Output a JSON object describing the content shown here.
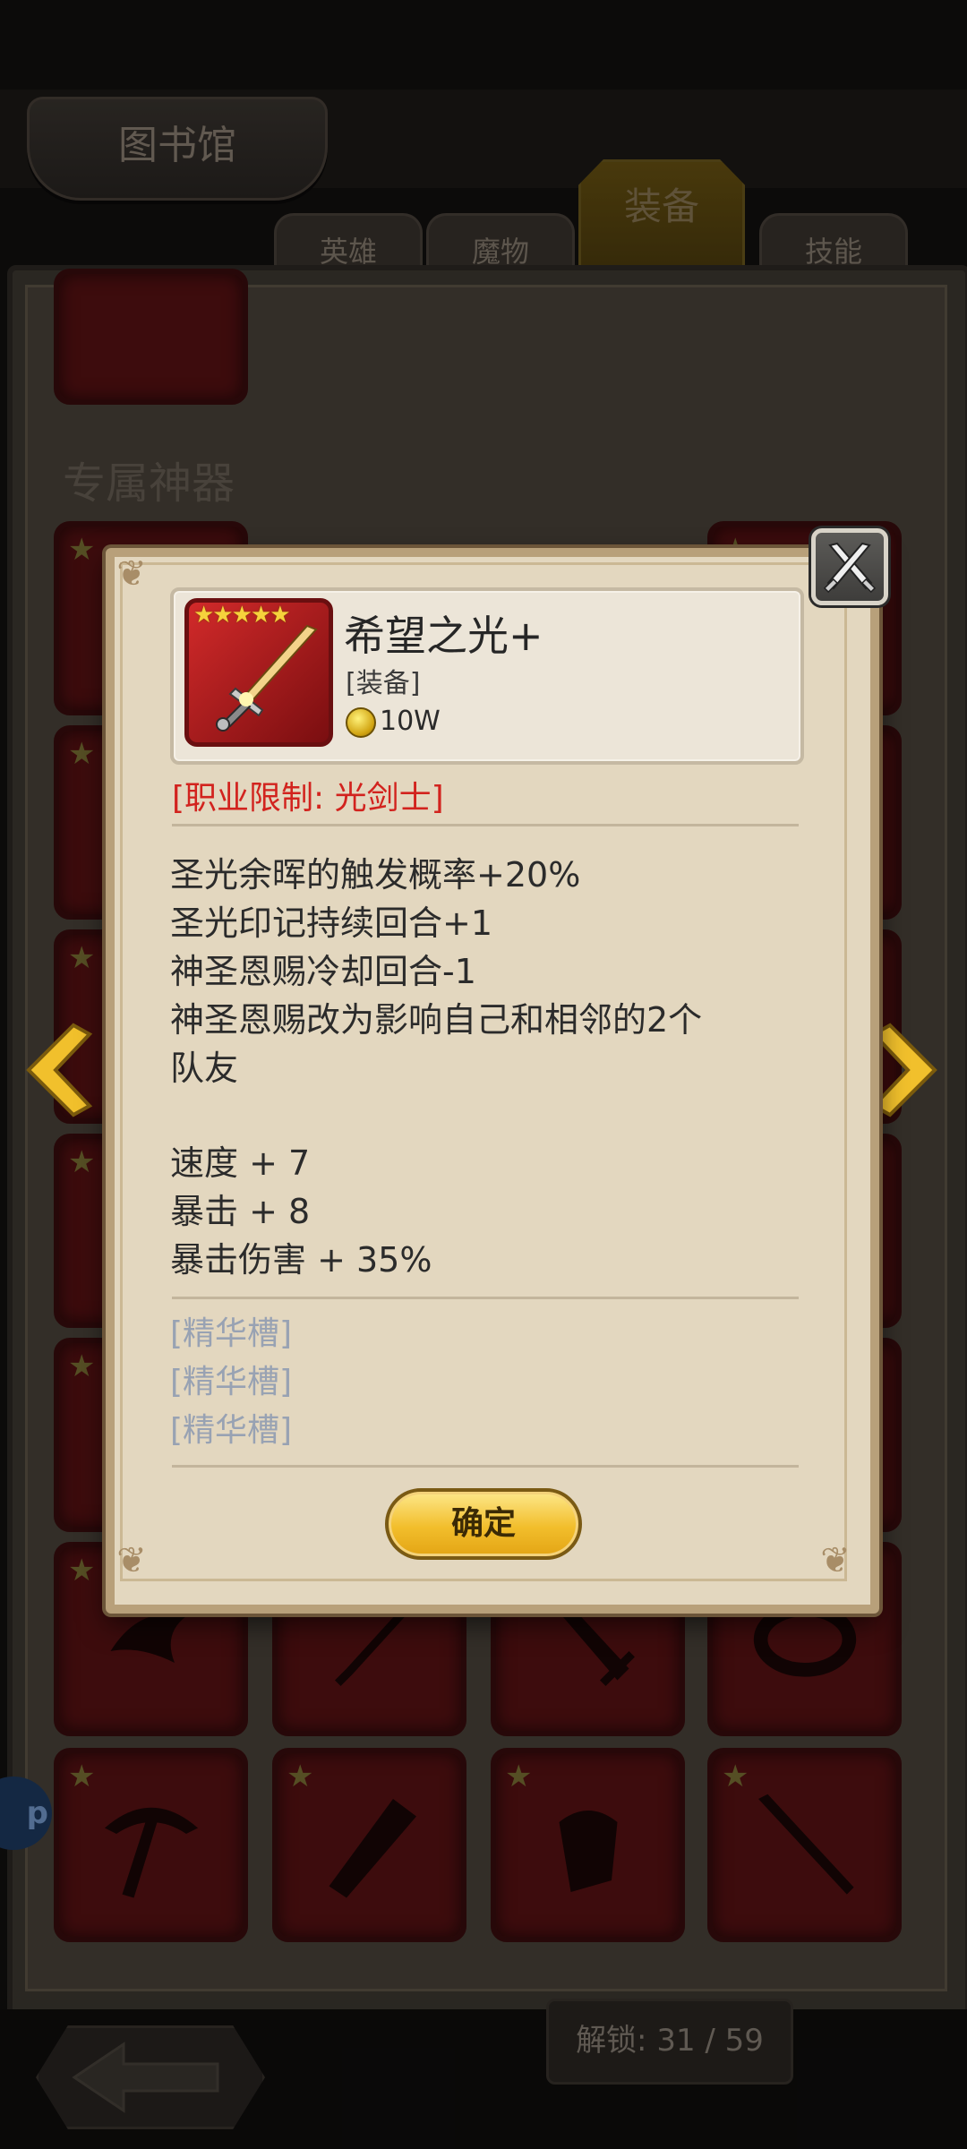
{
  "library": {
    "title": "图书馆",
    "tabs": [
      {
        "label": "英雄",
        "active": false
      },
      {
        "label": "魔物",
        "active": false
      },
      {
        "label": "装备",
        "active": true
      },
      {
        "label": "技能",
        "active": false
      }
    ],
    "section_title": "专属神器",
    "unlock_text": "解锁: 31 / 59",
    "app_bubble_text": "p"
  },
  "dialog": {
    "item_name": "希望之光+",
    "item_type": "[装备]",
    "price": "10W",
    "rarity_stars": "★★★★★",
    "job_restriction": "[职业限制: 光剑士]",
    "effects": [
      "圣光余晖的触发概率+20%",
      "圣光印记持续回合+1",
      "神圣恩赐冷却回合-1",
      "神圣恩赐改为影响自己和相邻的2个",
      "队友"
    ],
    "stats": [
      "速度 + 7",
      "暴击 + 8",
      "暴击伤害 + 35%"
    ],
    "essence_slots": [
      "[精华槽]",
      "[精华槽]",
      "[精华槽]"
    ],
    "confirm_label": "确定"
  },
  "icons": {
    "close": "crossed-swords-close-icon",
    "coin": "gold-coin-icon",
    "item": "sword-icon",
    "nav_prev": "chevron-left-icon",
    "nav_next": "chevron-right-icon",
    "back": "back-arrow-icon"
  },
  "colors": {
    "accent_gold": "#f2be2c",
    "restriction_red": "#d2231e",
    "slot_gray": "#98a2b3",
    "cell_red": "#5a1214"
  }
}
